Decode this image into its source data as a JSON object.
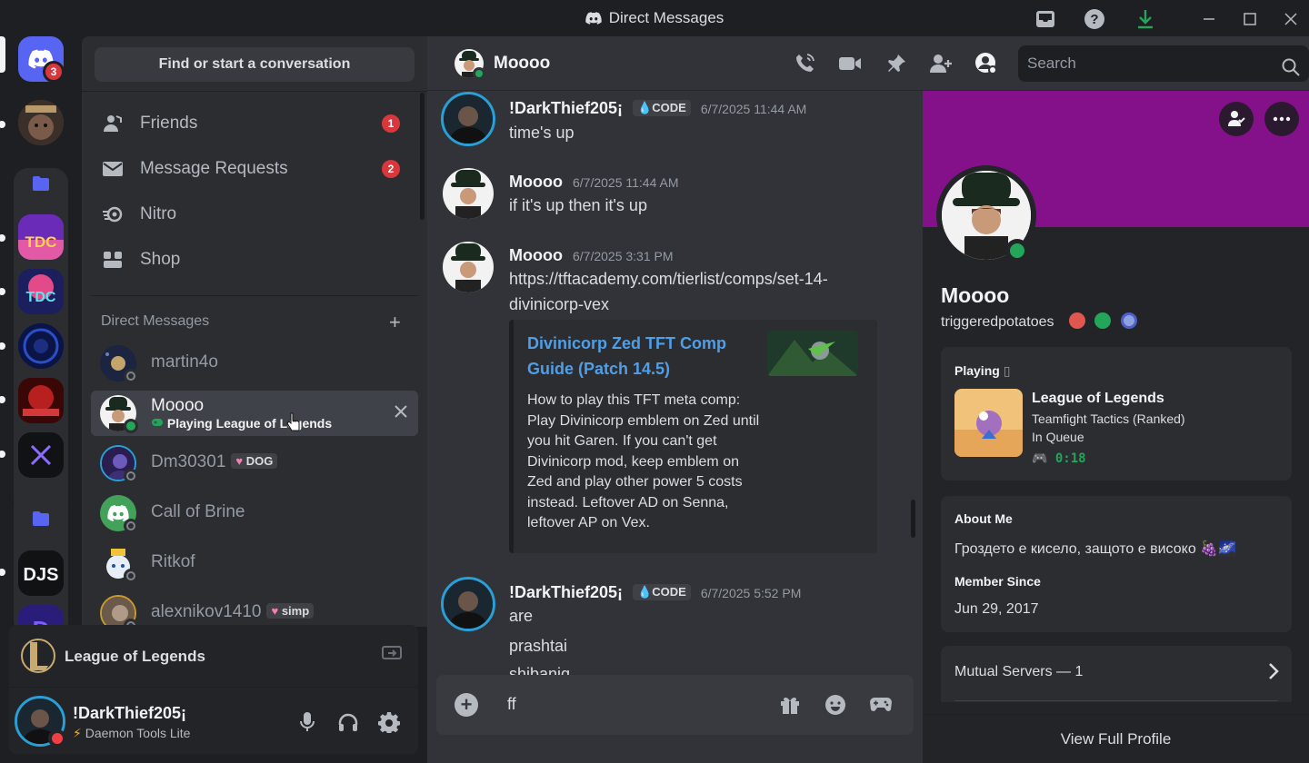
{
  "window": {
    "title": "Direct Messages"
  },
  "rail": {
    "home_badge": "3"
  },
  "sidebar": {
    "search_label": "Find or start a conversation",
    "nav": [
      {
        "label": "Friends",
        "badge": "1"
      },
      {
        "label": "Message Requests",
        "badge": "2"
      },
      {
        "label": "Nitro",
        "badge": ""
      },
      {
        "label": "Shop",
        "badge": ""
      }
    ],
    "dm_header": "Direct Messages",
    "dms": [
      {
        "name": "martin4o",
        "tag": "",
        "sub": ""
      },
      {
        "name": "Moooo",
        "tag": "",
        "sub": "Playing League of Legends"
      },
      {
        "name": "Dm30301",
        "tag": "DOG",
        "sub": ""
      },
      {
        "name": "Call of Brine",
        "tag": "",
        "sub": ""
      },
      {
        "name": "Ritkof",
        "tag": "",
        "sub": ""
      },
      {
        "name": "alexnikov1410",
        "tag": "simp",
        "sub": ""
      }
    ]
  },
  "activity": {
    "game": "League of Legends"
  },
  "user": {
    "name": "!DarkThief205¡",
    "status": "Daemon Tools Lite"
  },
  "chat": {
    "header_name": "Moooo",
    "search_placeholder": "Search",
    "messages": [
      {
        "author": "!DarkThief205¡",
        "tag": "CODE",
        "time": "6/7/2025 11:44 AM",
        "lines": [
          "time's up"
        ]
      },
      {
        "author": "Moooo",
        "tag": "",
        "time": "6/7/2025 11:44 AM",
        "lines": [
          "if it's up then it's up"
        ]
      },
      {
        "author": "Moooo",
        "tag": "",
        "time": "6/7/2025 3:31 PM",
        "lines": [
          "https://tftacademy.com/tierlist/comps/set-14-",
          "divinicorp-vex"
        ]
      },
      {
        "author": "!DarkThief205¡",
        "tag": "CODE",
        "time": "6/7/2025 5:52 PM",
        "lines": [
          "are",
          "prashtai",
          "shibaniq"
        ]
      }
    ],
    "embed": {
      "title": "Divinicorp Zed TFT Comp Guide (Patch 14.5)",
      "description": "How to play this TFT meta comp: Play Divinicorp emblem on Zed until you hit Garen. If you can't get Divinicorp mod, keep emblem on Zed and play other power 5 costs instead. Leftover AD on Senna, leftover AP on Vex."
    },
    "composer_text": "ff"
  },
  "profile": {
    "display_name": "Moooo",
    "username": "triggeredpotatoes",
    "playing_label": "Playing",
    "game": "League of Legends",
    "game_detail": "Teamfight Tactics (Ranked)",
    "game_state": "In Queue",
    "elapsed": "0:18",
    "about_label": "About Me",
    "about_text": "Гроздето е кисело, защото е високо 🍇🌌",
    "since_label": "Member Since",
    "since_date": "Jun 29, 2017",
    "mutual_servers": "Mutual Servers — 1",
    "view_full": "View Full Profile"
  },
  "colors": {
    "accent": "#5865f2",
    "banner": "#85118a",
    "online": "#23a55a",
    "dnd": "#f23f43",
    "link": "#4f9fe8"
  }
}
